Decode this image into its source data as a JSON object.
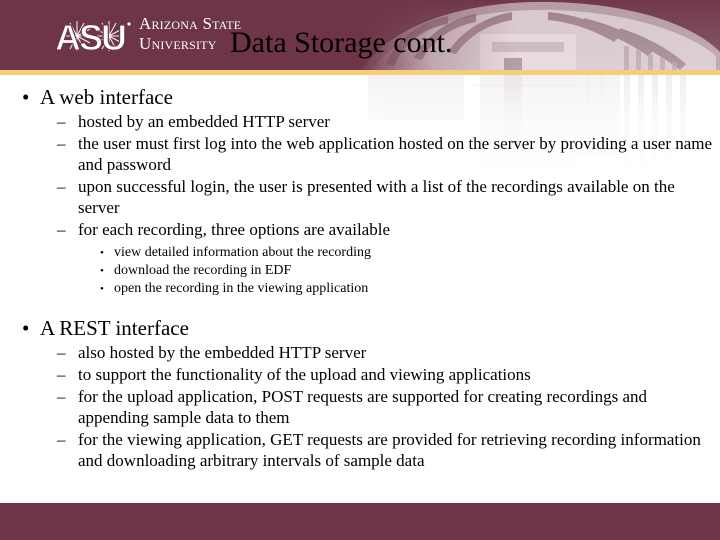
{
  "theme": {
    "maroon": "#6e3449",
    "gold": "#f5ce79",
    "text": "#000000",
    "background": "#ffffff"
  },
  "header": {
    "logo": {
      "mark_text": "ASU",
      "wordmark_line1": "Arizona State",
      "wordmark_line2": "University"
    },
    "title": "Data Storage cont."
  },
  "content": {
    "sections": [
      {
        "heading": "A web interface",
        "items": [
          {
            "text": "hosted by an embedded HTTP server",
            "subitems": []
          },
          {
            "text": "the user must first log into the web application hosted on the server by providing a user name and password",
            "subitems": []
          },
          {
            "text": "upon successful login, the user is presented with a list of the recordings available on the server",
            "subitems": []
          },
          {
            "text": "for each recording, three options are available",
            "subitems": [
              "view detailed information about the recording",
              "download the recording in EDF",
              "open the recording in the viewing application"
            ]
          }
        ]
      },
      {
        "heading": "A REST interface",
        "items": [
          {
            "text": "also hosted by the embedded HTTP server",
            "subitems": []
          },
          {
            "text": "to support the functionality of the upload and viewing applications",
            "subitems": []
          },
          {
            "text": "for the upload application, POST requests are supported for creating recordings and appending sample data to them",
            "subitems": []
          },
          {
            "text": "for the viewing application, GET requests are provided for retrieving recording information and downloading arbitrary intervals of sample data",
            "subitems": []
          }
        ]
      }
    ],
    "bullets": {
      "level1": "•",
      "level2": "–",
      "level3": "•"
    }
  }
}
